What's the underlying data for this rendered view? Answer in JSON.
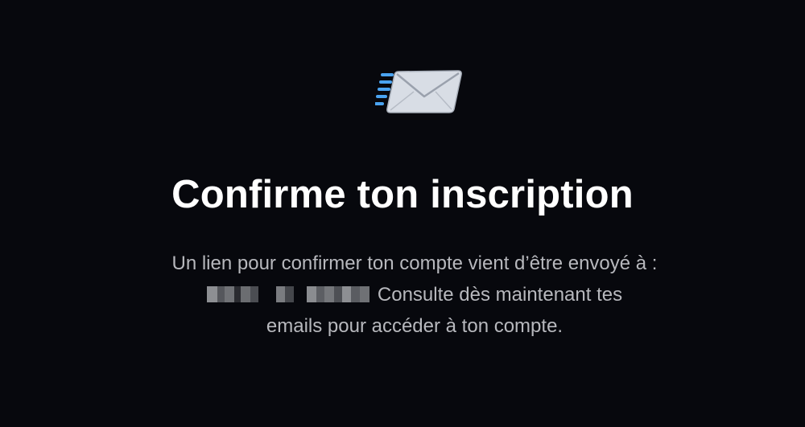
{
  "confirmation": {
    "title": "Confirme ton inscription",
    "line1": "Un lien pour confirmer ton compte vient d’être envoyé à :",
    "line2_after_email": "Consulte dès maintenant tes",
    "line3": "emails pour accéder à ton compte."
  },
  "icons": {
    "envelope": "envelope-icon"
  },
  "colors": {
    "background": "#07080d",
    "title": "#ffffff",
    "text": "#b7b8bd",
    "speed_lines": "#4aa3f0",
    "envelope": "#d8dde5"
  }
}
